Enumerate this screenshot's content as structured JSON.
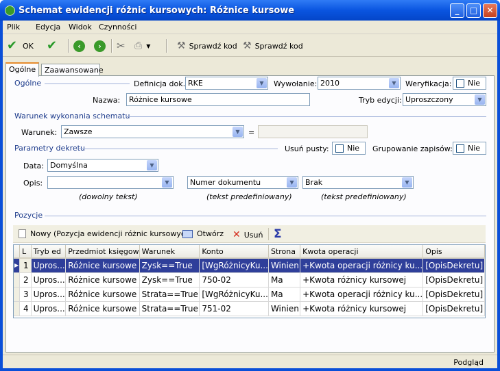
{
  "window": {
    "title": "Schemat ewidencji różnic kursowych: Różnice kursowe"
  },
  "menu": [
    "Plik",
    "Edycja",
    "Widok",
    "Czynności"
  ],
  "toolbar": {
    "ok_label": "OK",
    "check_code_1": "Sprawdź kod",
    "check_code_2": "Sprawdź kod"
  },
  "tabs": [
    "Ogólne",
    "Zaawansowane"
  ],
  "general": {
    "group_label": "Ogólne",
    "definicja_label": "Definicja dok.:",
    "definicja_value": "RKE",
    "wywolanie_label": "Wywołanie:",
    "wywolanie_value": "2010",
    "weryfikacja_label": "Weryfikacja:",
    "weryfikacja_value": "Nie",
    "nazwa_label": "Nazwa:",
    "nazwa_value": "Różnice kursowe",
    "tryb_label": "Tryb edycji:",
    "tryb_value": "Uproszczony"
  },
  "condition": {
    "group_label": "Warunek wykonania schematu",
    "warunek_label": "Warunek:",
    "warunek_value": "Zawsze",
    "equals": "="
  },
  "decree": {
    "group_label": "Parametry dekretu",
    "usun_label": "Usuń pusty:",
    "usun_value": "Nie",
    "grupowanie_label": "Grupowanie zapisów:",
    "grupowanie_value": "Nie",
    "data_label": "Data:",
    "data_value": "Domyślna",
    "opis_label": "Opis:",
    "opis_value": "",
    "opis2_value": "Numer dokumentu",
    "opis3_value": "Brak",
    "hint1": "(dowolny tekst)",
    "hint2": "(tekst predefiniowany)",
    "hint3": "(tekst predefiniowany)"
  },
  "positions": {
    "group_label": "Pozycje",
    "new_label": "Nowy (Pozycja ewidencji różnic kursowych)",
    "open_label": "Otwórz",
    "delete_label": "Usuń",
    "columns": [
      "L",
      "Tryb ed",
      "Przedmiot księgow",
      "Warunek",
      "Konto",
      "Strona",
      "Kwota operacji",
      "Opis"
    ],
    "rows": [
      [
        "1",
        "Upros...",
        "Różnice kursowe",
        "Zysk==True",
        "[WgRóżnicyKu...",
        "Winien",
        "+Kwota operacji różnicy ku...",
        "[OpisDekretu]"
      ],
      [
        "2",
        "Upros...",
        "Różnice kursowe",
        "Zysk==True",
        "750-02",
        "Ma",
        "+Kwota różnicy kursowej",
        "[OpisDekretu]"
      ],
      [
        "3",
        "Upros...",
        "Różnice kursowe",
        "Strata==True",
        "[WgRóżnicyKu...",
        "Ma",
        "+Kwota operacji różnicy ku...",
        "[OpisDekretu]"
      ],
      [
        "4",
        "Upros...",
        "Różnice kursowe",
        "Strata==True",
        "751-02",
        "Winien",
        "+Kwota różnicy kursowej",
        "[OpisDekretu]"
      ]
    ]
  },
  "status": {
    "right_text": "Podgląd"
  }
}
